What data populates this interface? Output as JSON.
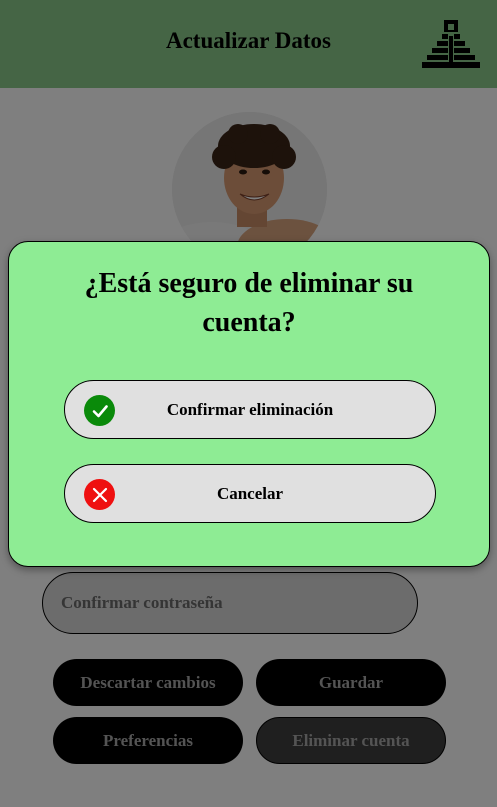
{
  "header": {
    "title": "Actualizar Datos",
    "logo_icon": "pyramid-icon"
  },
  "form": {
    "confirm_password_placeholder": "Confirmar contraseña"
  },
  "actions": {
    "discard": "Descartar cambios",
    "save": "Guardar",
    "preferences": "Preferencias",
    "delete_account": "Eliminar cuenta"
  },
  "modal": {
    "title": "¿Está seguro de eliminar su cuenta?",
    "confirm": {
      "label": "Confirmar eliminación",
      "icon": "check-circle-icon",
      "color": "#0a8a0a"
    },
    "cancel": {
      "label": "Cancelar",
      "icon": "close-circle-icon",
      "color": "#ef1010"
    }
  },
  "colors": {
    "header_bg": "#8aca8a",
    "modal_bg": "#8eec94",
    "button_bg": "#000000"
  }
}
